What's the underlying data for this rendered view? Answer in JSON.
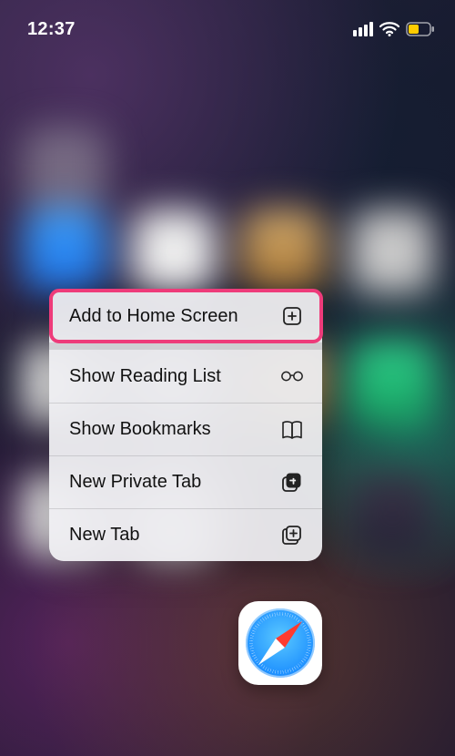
{
  "status_bar": {
    "time": "12:37",
    "cellular_bars": 4,
    "wifi": true,
    "battery_low_power": true
  },
  "context_menu": {
    "app": "Safari",
    "highlighted_index": 0,
    "highlight_color": "#ee3b7a",
    "items": [
      {
        "label": "Add to Home Screen",
        "icon": "plus-square-icon",
        "group": 0
      },
      {
        "label": "Show Reading List",
        "icon": "glasses-icon",
        "group": 1
      },
      {
        "label": "Show Bookmarks",
        "icon": "book-icon",
        "group": 1
      },
      {
        "label": "New Private Tab",
        "icon": "private-tab-icon",
        "group": 1
      },
      {
        "label": "New Tab",
        "icon": "new-tab-icon",
        "group": 1
      }
    ]
  },
  "app_icon": {
    "name": "Safari"
  }
}
